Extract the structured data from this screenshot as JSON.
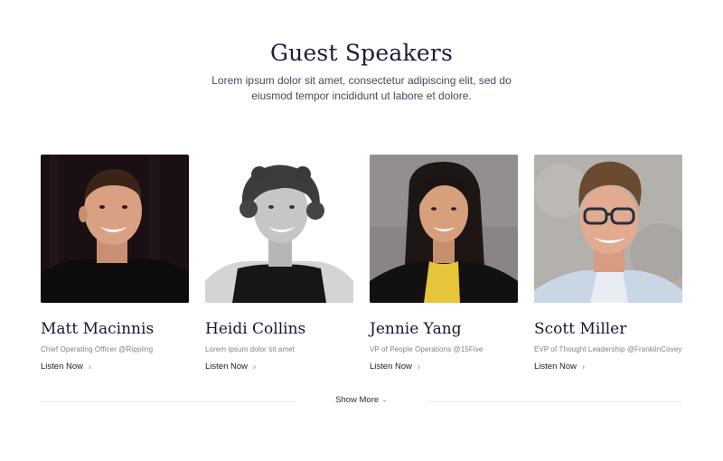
{
  "section": {
    "title": "Guest Speakers",
    "subtitle": "Lorem ipsum dolor sit amet, consectetur adipiscing elit, sed do eiusmod tempor incididunt ut labore et dolore."
  },
  "speakers": [
    {
      "name": "Matt Macinnis",
      "role": "Chief Operating Officer @Rippling",
      "cta": "Listen Now"
    },
    {
      "name": "Heidi Collins",
      "role": "Lorem ipsum dolor sit amet",
      "cta": "Listen Now"
    },
    {
      "name": "Jennie Yang",
      "role": "VP of People Operations @15Five",
      "cta": "Listen Now"
    },
    {
      "name": "Scott Miller",
      "role": "EVP of Thought Leadership @FranklinCovey",
      "cta": "Listen Now"
    }
  ],
  "footer": {
    "show_more_label": "Show More"
  },
  "icons": {
    "listen_chevron": "chevron-right-icon",
    "show_more_chevron": "chevron-down-icon"
  }
}
